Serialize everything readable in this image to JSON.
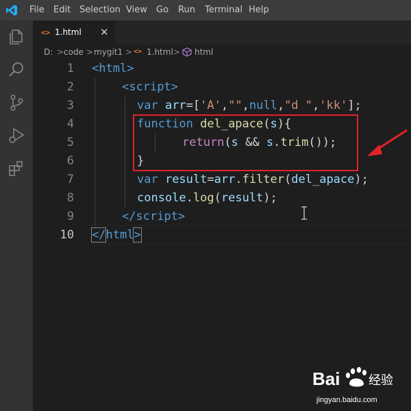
{
  "menu": [
    "File",
    "Edit",
    "Selection",
    "View",
    "Go",
    "Run",
    "Terminal",
    "Help"
  ],
  "tab": {
    "icon": "<>",
    "label": "1.html",
    "close": "✕"
  },
  "breadcrumb": {
    "parts": [
      "D:",
      "code",
      "mygit1",
      "1.html",
      "html"
    ],
    "sep": ">"
  },
  "editor": {
    "line_numbers": [
      "1",
      "2",
      "3",
      "4",
      "5",
      "6",
      "7",
      "8",
      "9",
      "10"
    ],
    "lines": [
      [
        [
          "tag",
          "<"
        ],
        [
          "tag",
          "html"
        ],
        [
          "tag",
          ">"
        ]
      ],
      [
        [
          "tag",
          "<"
        ],
        [
          "tag",
          "script"
        ],
        [
          "tag",
          ">"
        ]
      ],
      [
        [
          "kw",
          "var "
        ],
        [
          "var",
          "arr"
        ],
        [
          "txt",
          "=["
        ],
        [
          "str",
          "'A'"
        ],
        [
          "txt",
          ","
        ],
        [
          "str",
          "\"\""
        ],
        [
          "txt",
          ","
        ],
        [
          "kw",
          "null"
        ],
        [
          "txt",
          ","
        ],
        [
          "str",
          "\"d \""
        ],
        [
          "txt",
          ","
        ],
        [
          "str",
          "'kk'"
        ],
        [
          "txt",
          "];"
        ]
      ],
      [
        [
          "kw",
          "function "
        ],
        [
          "fn",
          "del_apace"
        ],
        [
          "txt",
          "("
        ],
        [
          "var",
          "s"
        ],
        [
          "txt",
          "){"
        ]
      ],
      [
        [
          "ctl",
          "return"
        ],
        [
          "txt",
          "("
        ],
        [
          "var",
          "s"
        ],
        [
          "txt",
          " && "
        ],
        [
          "var",
          "s"
        ],
        [
          "txt",
          "."
        ],
        [
          "fn",
          "trim"
        ],
        [
          "txt",
          "());"
        ]
      ],
      [
        [
          "txt",
          "}"
        ]
      ],
      [
        [
          "kw",
          "var "
        ],
        [
          "var",
          "result"
        ],
        [
          "txt",
          "="
        ],
        [
          "var",
          "arr"
        ],
        [
          "txt",
          "."
        ],
        [
          "fn",
          "filter"
        ],
        [
          "txt",
          "("
        ],
        [
          "var",
          "del_apace"
        ],
        [
          "txt",
          ");"
        ]
      ],
      [
        [
          "var",
          "console"
        ],
        [
          "txt",
          "."
        ],
        [
          "fn",
          "log"
        ],
        [
          "txt",
          "("
        ],
        [
          "var",
          "result"
        ],
        [
          "txt",
          ");"
        ]
      ],
      [
        [
          "tag",
          "</"
        ],
        [
          "tag",
          "script"
        ],
        [
          "tag",
          ">"
        ]
      ],
      [
        [
          "tag",
          "</"
        ],
        [
          "tag",
          "html"
        ],
        [
          "tag",
          ">"
        ]
      ]
    ]
  },
  "watermark": {
    "brand": "Bai",
    "brand_cn": "经验",
    "url": "jingyan.baidu.com"
  },
  "colors": {
    "menubar": "#3c3c3c",
    "activitybar": "#333333",
    "editor_bg": "#1e1e1e",
    "highlight": "#e2232a"
  },
  "icons": [
    "vscode-logo-icon",
    "explorer-icon",
    "search-icon",
    "source-control-icon",
    "run-debug-icon",
    "extensions-icon",
    "html-file-icon",
    "close-icon",
    "chevron-right-icon",
    "symbol-icon",
    "red-arrow-icon",
    "text-cursor-icon"
  ]
}
